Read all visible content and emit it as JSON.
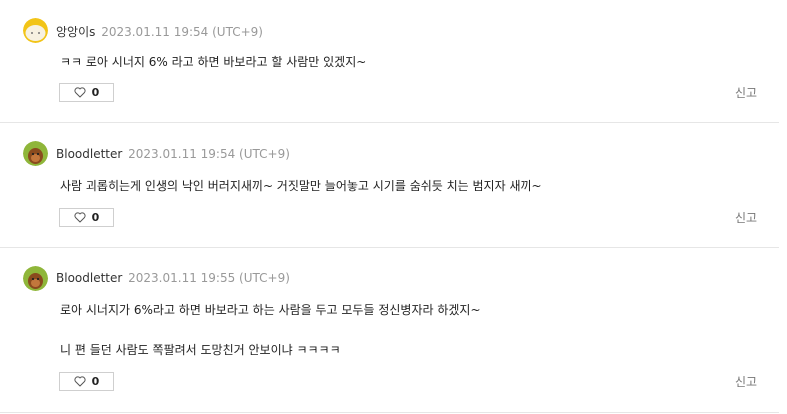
{
  "comments": [
    {
      "author": "앙앙이s",
      "date": "2023.01.11 19:54 (UTC+9)",
      "lines": [
        "ㅋㅋ 로아 시너지 6% 라고 하면 바보라고 할 사람만 있겠지~"
      ],
      "likes": "0",
      "report": "신고",
      "avatar_icon": "yellow-face-avatar-icon"
    },
    {
      "author": "Bloodletter",
      "date": "2023.01.11 19:54 (UTC+9)",
      "lines": [
        "사람 괴롭히는게 인생의 낙인 버러지새끼~ 거짓말만 늘어놓고 시기를 숨쉬듯 치는 범지자 새끼~"
      ],
      "likes": "0",
      "report": "신고",
      "avatar_icon": "green-monkey-avatar-icon"
    },
    {
      "author": "Bloodletter",
      "date": "2023.01.11 19:55 (UTC+9)",
      "lines": [
        "로아 시너지가 6%라고 하면 바보라고 하는 사람을 두고 모두들 정신병자라 하겠지~",
        "니 편 들던 사람도 쪽팔려서 도망친거 안보이냐 ㅋㅋㅋㅋ"
      ],
      "likes": "0",
      "report": "신고",
      "avatar_icon": "green-monkey-avatar-icon"
    }
  ],
  "colors": {
    "date": "#999999",
    "divider": "#e6e6e6",
    "like_border": "#cfcfcf",
    "report": "#777777"
  }
}
